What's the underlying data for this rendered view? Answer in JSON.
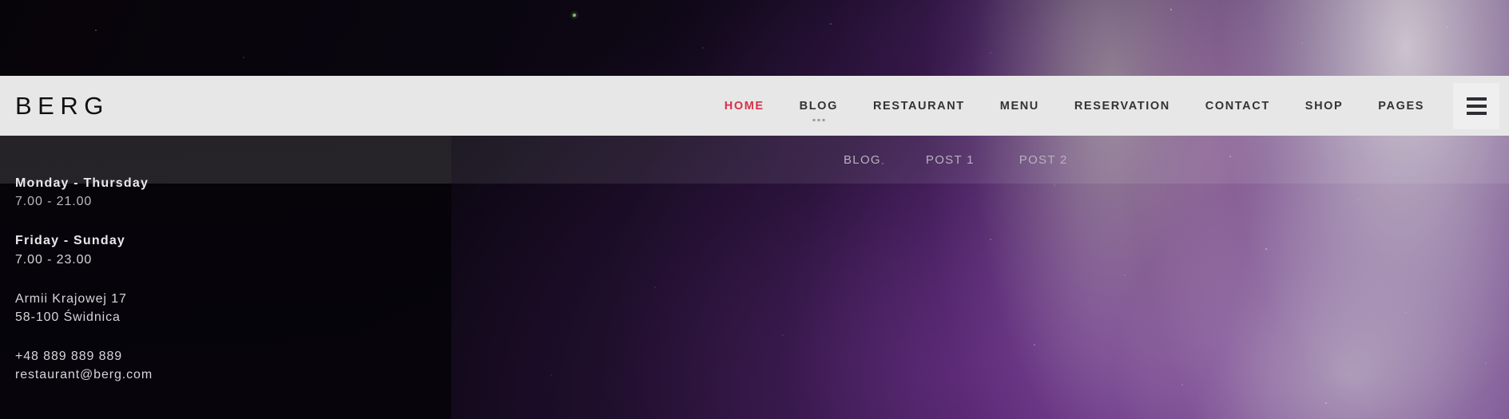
{
  "site": {
    "logo": "BERG"
  },
  "header": {
    "nav": [
      {
        "label": "HOME",
        "active": true,
        "has_dots": false
      },
      {
        "label": "BLOG",
        "active": false,
        "has_dots": true
      },
      {
        "label": "RESTAURANT",
        "active": false,
        "has_dots": false
      },
      {
        "label": "MENU",
        "active": false,
        "has_dots": false
      },
      {
        "label": "RESERVATION",
        "active": false,
        "has_dots": false
      },
      {
        "label": "CONTACT",
        "active": false,
        "has_dots": false
      },
      {
        "label": "SHOP",
        "active": false,
        "has_dots": false
      },
      {
        "label": "PAGES",
        "active": false,
        "has_dots": false
      }
    ],
    "menu_icon": "hamburger-icon",
    "background_color": "#e7e7e7",
    "active_color": "#d8304a",
    "text_color": "#333333"
  },
  "submenu": {
    "items": [
      {
        "label": "BLOG"
      },
      {
        "label": "POST 1"
      },
      {
        "label": "POST 2"
      }
    ],
    "text_color": "#b7b2bd"
  },
  "info_panel": {
    "hours": [
      {
        "days": "Monday - Thursday",
        "time": "7.00 - 21.00"
      },
      {
        "days": "Friday - Sunday",
        "time": "7.00 - 23.00"
      }
    ],
    "address": {
      "street": "Armii Krajowej 17",
      "city": "58-100 Świdnica"
    },
    "contact": {
      "phone": "+48 889 889 889",
      "email": "restaurant@berg.com"
    }
  }
}
